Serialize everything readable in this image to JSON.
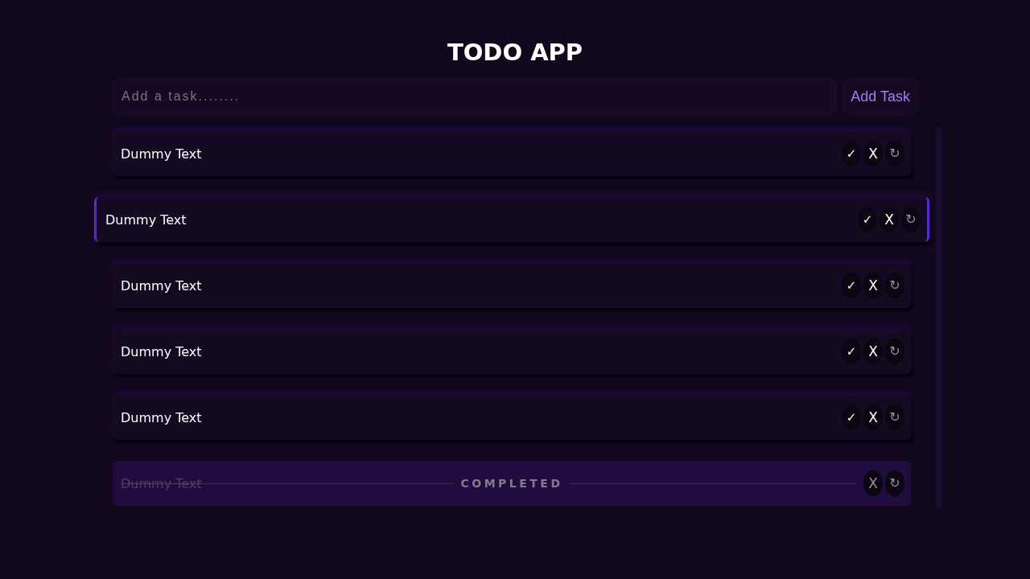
{
  "title": "TODO APP",
  "new_task": {
    "placeholder": "Add a task........"
  },
  "add_button": "Add Task",
  "tasks": [
    {
      "text": "Dummy Text",
      "selected": false,
      "completed": false,
      "actions": [
        {
          "kind": "done",
          "label": "✓"
        },
        {
          "kind": "delete",
          "label": "X"
        },
        {
          "kind": "reset",
          "label": "↻"
        }
      ]
    },
    {
      "text": "Dummy Text",
      "selected": true,
      "completed": false,
      "actions": [
        {
          "kind": "done",
          "label": "✓"
        },
        {
          "kind": "delete",
          "label": "X"
        },
        {
          "kind": "reset",
          "label": "↻"
        }
      ]
    },
    {
      "text": "Dummy Text",
      "selected": false,
      "completed": false,
      "actions": [
        {
          "kind": "done",
          "label": "✓"
        },
        {
          "kind": "delete",
          "label": "X"
        },
        {
          "kind": "reset",
          "label": "↻"
        }
      ]
    },
    {
      "text": "Dummy Text",
      "selected": false,
      "completed": false,
      "actions": [
        {
          "kind": "done",
          "label": "✓"
        },
        {
          "kind": "delete",
          "label": "X"
        },
        {
          "kind": "reset",
          "label": "↻"
        }
      ]
    },
    {
      "text": "Dummy Text",
      "selected": false,
      "completed": false,
      "actions": [
        {
          "kind": "done",
          "label": "✓"
        },
        {
          "kind": "delete",
          "label": "X"
        },
        {
          "kind": "reset",
          "label": "↻"
        }
      ]
    },
    {
      "text": "Dummy Text",
      "selected": false,
      "completed": true,
      "status_label": "COMPLETED",
      "actions": [
        {
          "kind": "delete",
          "label": "X"
        },
        {
          "kind": "reset",
          "label": "↻"
        }
      ]
    }
  ]
}
